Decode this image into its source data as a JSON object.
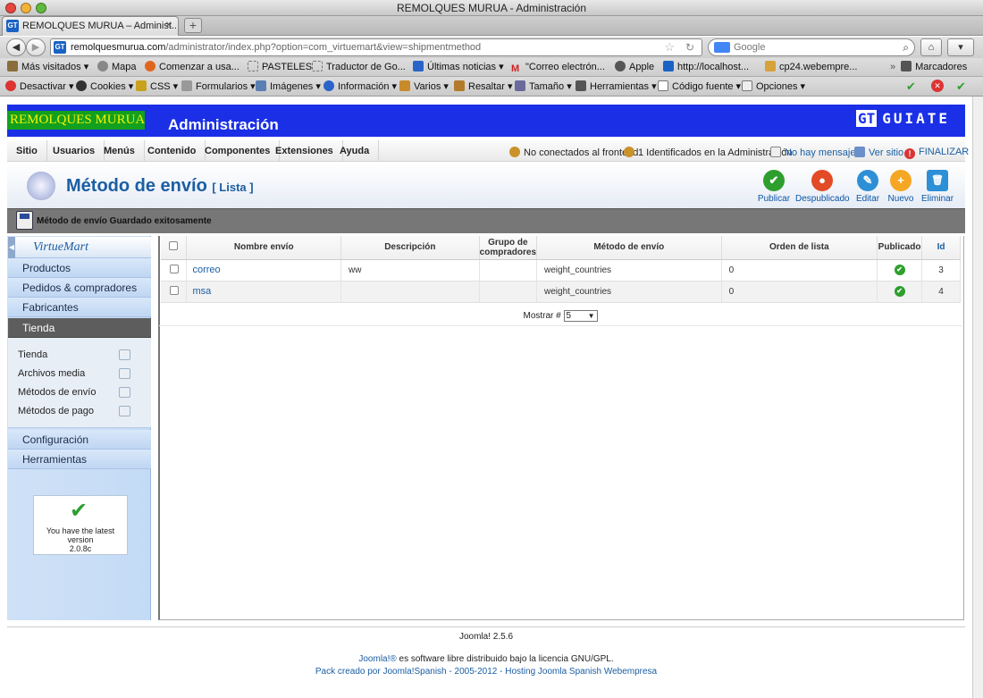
{
  "window": {
    "title": "REMOLQUES MURUA - Administración"
  },
  "tab": {
    "label": "REMOLQUES MURUA – Administ..."
  },
  "nav": {
    "url_host": "remolquesmurua.com",
    "url_path": "/administrator/index.php?option=com_virtuemart&view=shipmentmethod",
    "search_placeholder": "Google"
  },
  "bookmarks": [
    "Más visitados",
    "Mapa",
    "Comenzar a usa...",
    "PASTELES",
    "Traductor de Go...",
    "Últimas noticias",
    "\"Correo electrón...",
    "Apple",
    "http://localhost...",
    "cp24.webempre...",
    "Marcadores"
  ],
  "devbar": [
    "Desactivar",
    "Cookies",
    "CSS",
    "Formularios",
    "Imágenes",
    "Información",
    "Varios",
    "Resaltar",
    "Tamaño",
    "Herramientas",
    "Código fuente",
    "Opciones"
  ],
  "header": {
    "logo": "REMOLQUES MURUA",
    "title": "Administración",
    "brand": "GUIATE"
  },
  "menu": [
    "Sitio",
    "Usuarios",
    "Menús",
    "Contenido",
    "Componentes",
    "Extensiones",
    "Ayuda"
  ],
  "status": {
    "frontend": "No conectados al frontend",
    "admins": "1 Identificados en la Administración",
    "messages": "No hay mensajes",
    "view_site": "Ver sitio",
    "logout": "FINALIZAR"
  },
  "page": {
    "title": "Método de envío",
    "subtitle": "[ Lista ]"
  },
  "toolbar": [
    {
      "label": "Publicar",
      "color": "#2e9e2e",
      "glyph": "✔"
    },
    {
      "label": "Despublicado",
      "color": "#e24b26",
      "glyph": "●"
    },
    {
      "label": "Editar",
      "color": "#2d8fd6",
      "glyph": "✎"
    },
    {
      "label": "Nuevo",
      "color": "#f5a623",
      "glyph": "+"
    },
    {
      "label": "Eliminar",
      "color": "#2d8fd6",
      "glyph": "🗑"
    }
  ],
  "message": "Método de envío Guardado exitosamente",
  "sidebar": {
    "brand": "VirtueMart",
    "sections": [
      "Productos",
      "Pedidos & compradores",
      "Fabricantes",
      "Tienda"
    ],
    "sub_items": [
      "Tienda",
      "Archivos media",
      "Métodos de envío",
      "Métodos de pago"
    ],
    "bottom_sections": [
      "Configuración",
      "Herramientas"
    ],
    "notice_line1": "You have the latest",
    "notice_line2": "version",
    "notice_version": "2.0.8c"
  },
  "table": {
    "headers": [
      "Nombre envío",
      "Descripción",
      "Grupo de compradores",
      "Método de envío",
      "Orden de lista",
      "Publicado",
      "Id"
    ],
    "rows": [
      {
        "name": "correo",
        "description": "ww",
        "group": "",
        "method": "weight_countries",
        "order": "0",
        "id": "3"
      },
      {
        "name": "msa",
        "description": "",
        "group": "",
        "method": "weight_countries",
        "order": "0",
        "id": "4"
      }
    ],
    "pager_label": "Mostrar #",
    "pager_value": "5"
  },
  "footer": {
    "version": "Joomla! 2.5.6",
    "license_link": "Joomla!®",
    "license_text": " es software libre distribuido bajo la licencia GNU/GPL.",
    "credits": "Pack creado por Joomla!Spanish - 2005-2012 - Hosting Joomla Spanish Webempresa"
  }
}
